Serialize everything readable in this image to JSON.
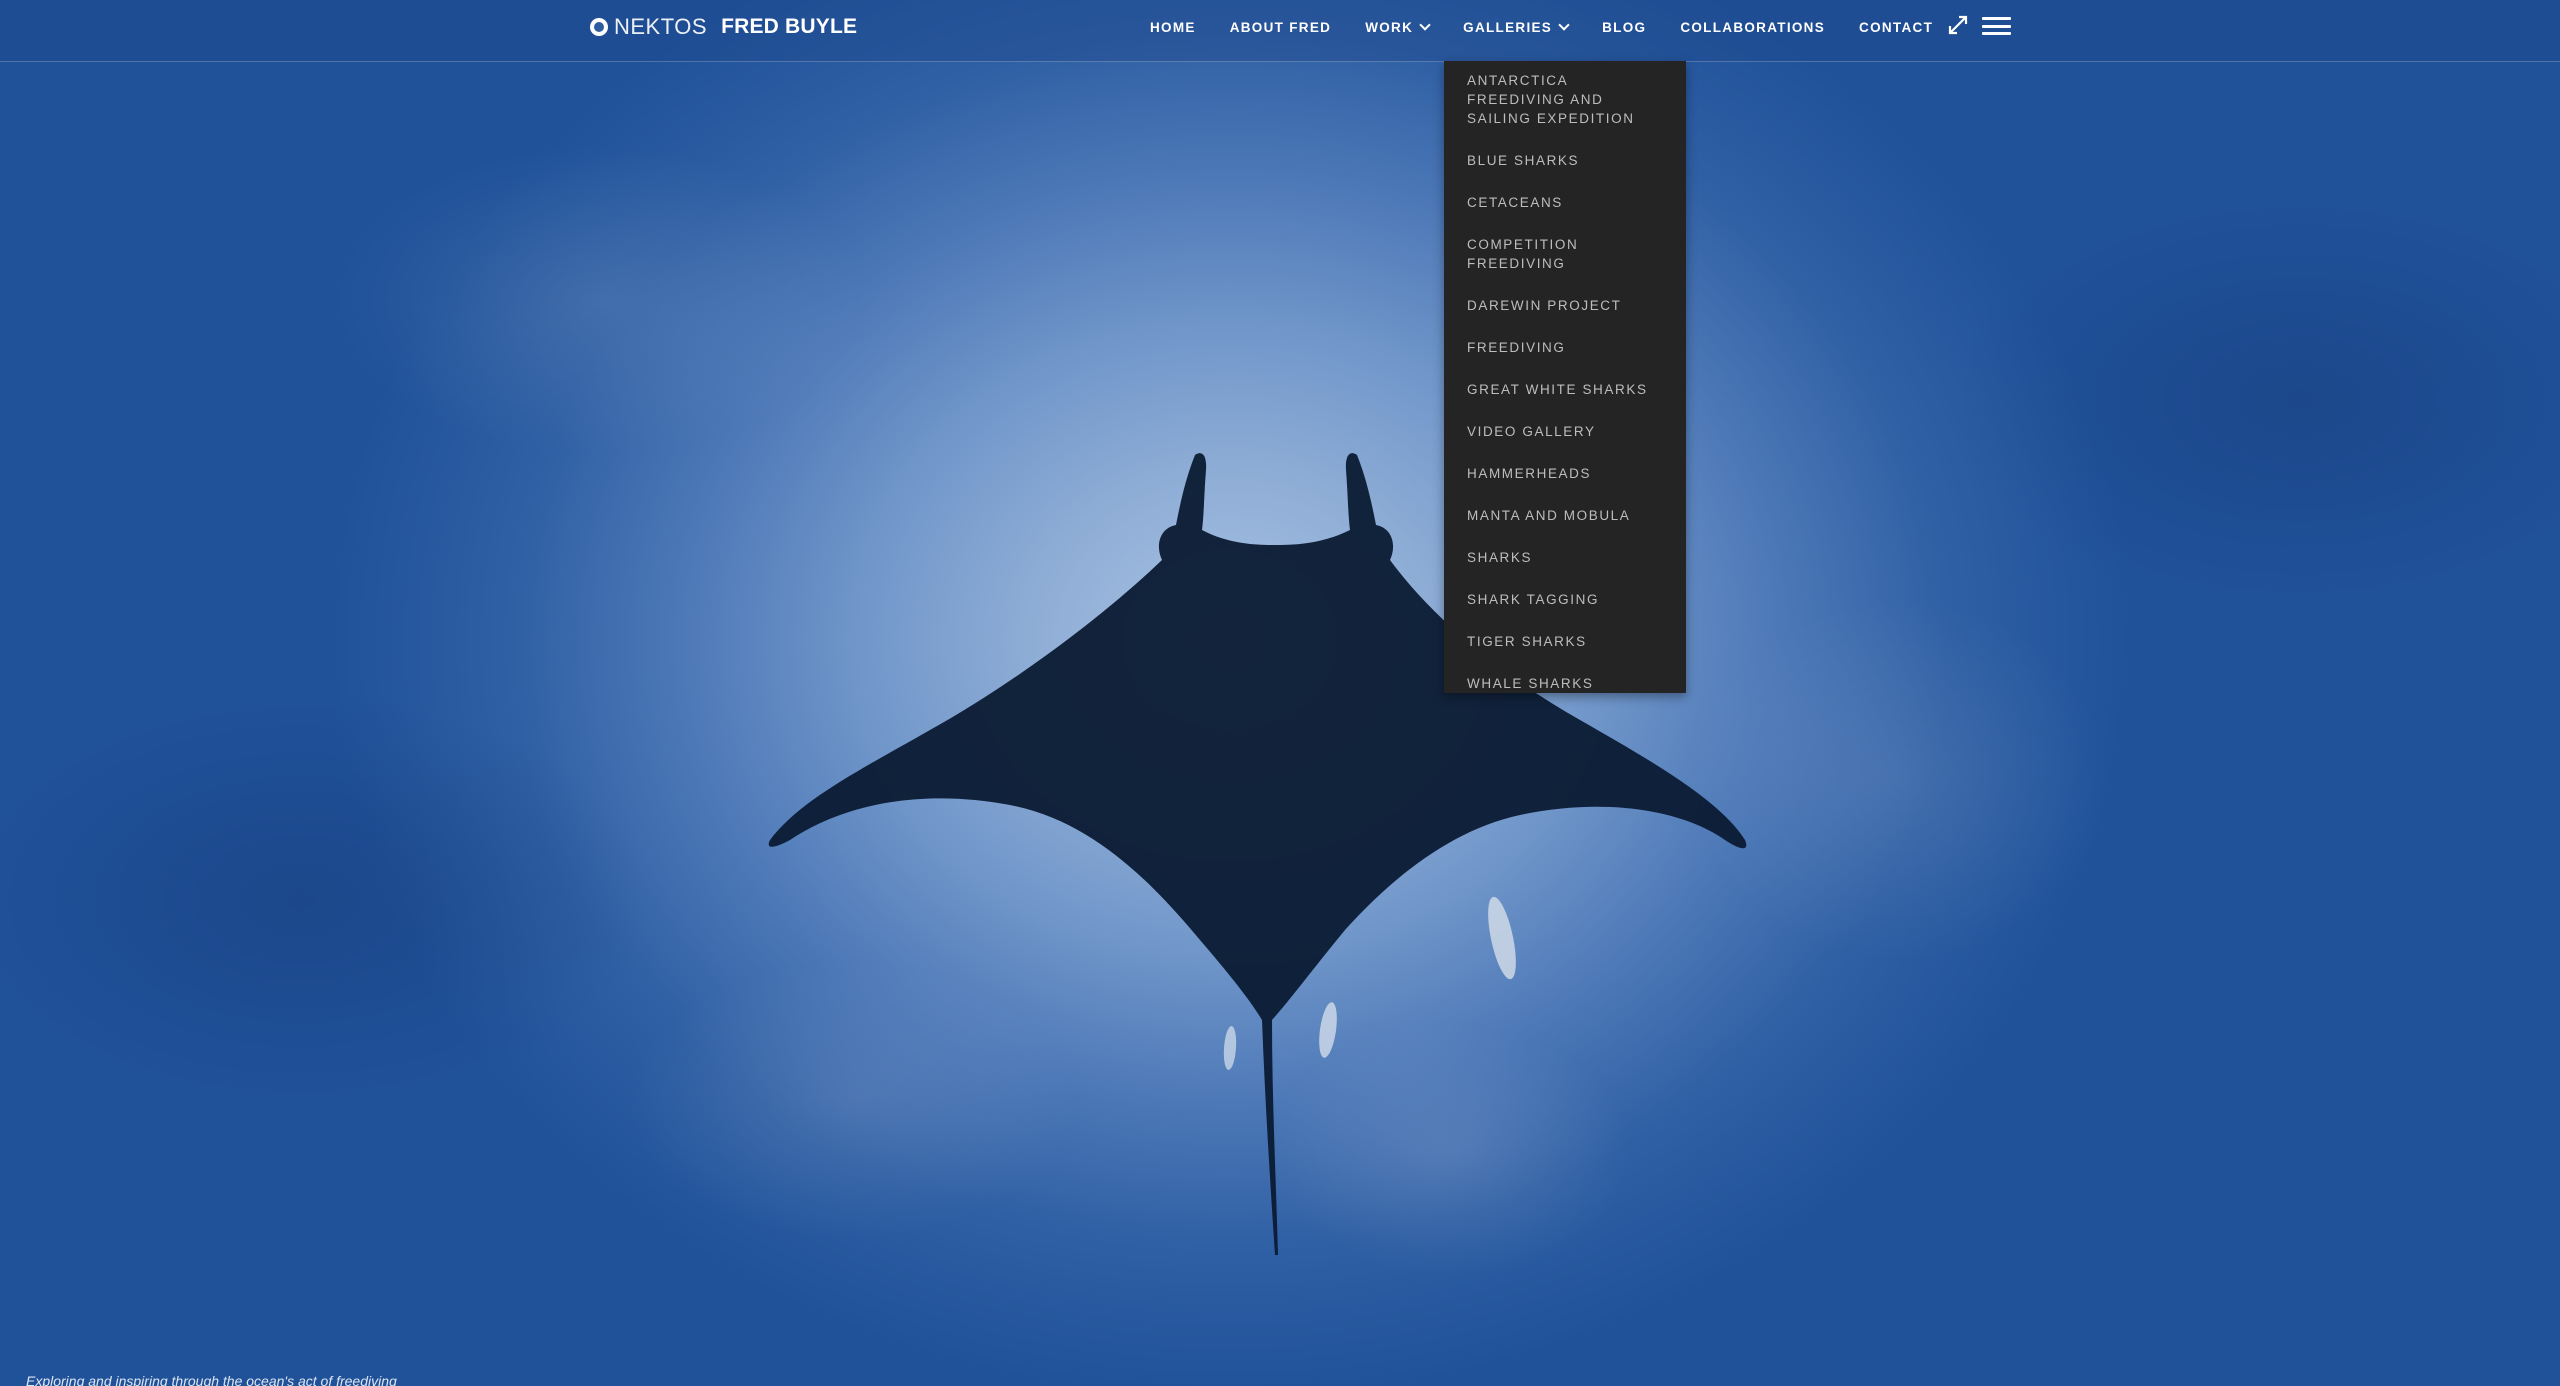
{
  "brand": {
    "logo_text": "NEKTOS",
    "logo_icon": "nektos-logo-icon",
    "name": "FRED BUYLE"
  },
  "nav": {
    "items": [
      {
        "label": "HOME"
      },
      {
        "label": "ABOUT FRED"
      },
      {
        "label": "WORK",
        "has_dropdown": true
      },
      {
        "label": "GALLERIES",
        "has_dropdown": true
      },
      {
        "label": "BLOG"
      },
      {
        "label": "COLLABORATIONS"
      },
      {
        "label": "CONTACT"
      }
    ],
    "icons": [
      "expand-icon",
      "hamburger-menu-icon"
    ]
  },
  "galleries_dropdown": {
    "items": [
      {
        "label": "ANTARCTICA FREEDIVING AND SAILING EXPEDITION"
      },
      {
        "label": "BLUE SHARKS"
      },
      {
        "label": "CETACEANS"
      },
      {
        "label": "COMPETITION FREEDIVING"
      },
      {
        "label": "DAREWIN PROJECT"
      },
      {
        "label": "FREEDIVING"
      },
      {
        "label": "GREAT WHITE SHARKS"
      },
      {
        "label": "VIDEO GALLERY"
      },
      {
        "label": "HAMMERHEADS"
      },
      {
        "label": "MANTA AND MOBULA"
      },
      {
        "label": "SHARKS"
      },
      {
        "label": "SHARK TAGGING"
      },
      {
        "label": "TIGER SHARKS"
      },
      {
        "label": "WHALE SHARKS"
      }
    ]
  },
  "hero": {
    "caption": "Exploring and inspiring through the ocean's act of freediving"
  },
  "colors": {
    "header_bg": "#1c4687",
    "dropdown_bg": "#242424",
    "dropdown_text": "#bdbdbd",
    "water_light": "#a9c2e2",
    "water_dark": "#20529a"
  }
}
